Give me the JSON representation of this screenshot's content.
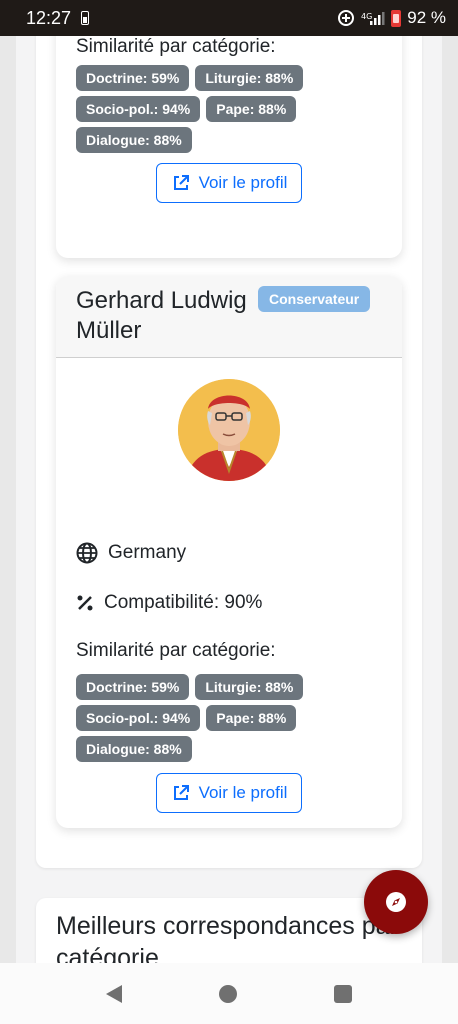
{
  "status_bar": {
    "time": "12:27",
    "battery_percent": "92 %",
    "signal_label": "4G"
  },
  "match_card_top": {
    "similarity_title": "Similarité par catégorie:",
    "badges": [
      "Doctrine: 59%",
      "Liturgie: 88%",
      "Socio-pol.: 94%",
      "Pape: 88%",
      "Dialogue: 88%"
    ],
    "profile_button_label": "Voir le profil"
  },
  "match_card": {
    "name": "Gerhard Ludwig Müller",
    "tendency_badge": "Conservateur",
    "country": "Germany",
    "compatibility": "Compatibilité: 90%",
    "similarity_title": "Similarité par catégorie:",
    "badges": [
      "Doctrine: 59%",
      "Liturgie: 88%",
      "Socio-pol.: 94%",
      "Pape: 88%",
      "Dialogue: 88%"
    ],
    "profile_button_label": "Voir le profil"
  },
  "best_matches_section": {
    "heading": "Meilleurs correspondances par catégorie"
  },
  "colors": {
    "accent": "#0d6efd",
    "badge_gray": "#6c757d",
    "conservative_badge": "#86b7e6",
    "fab": "#8b0a0a"
  }
}
